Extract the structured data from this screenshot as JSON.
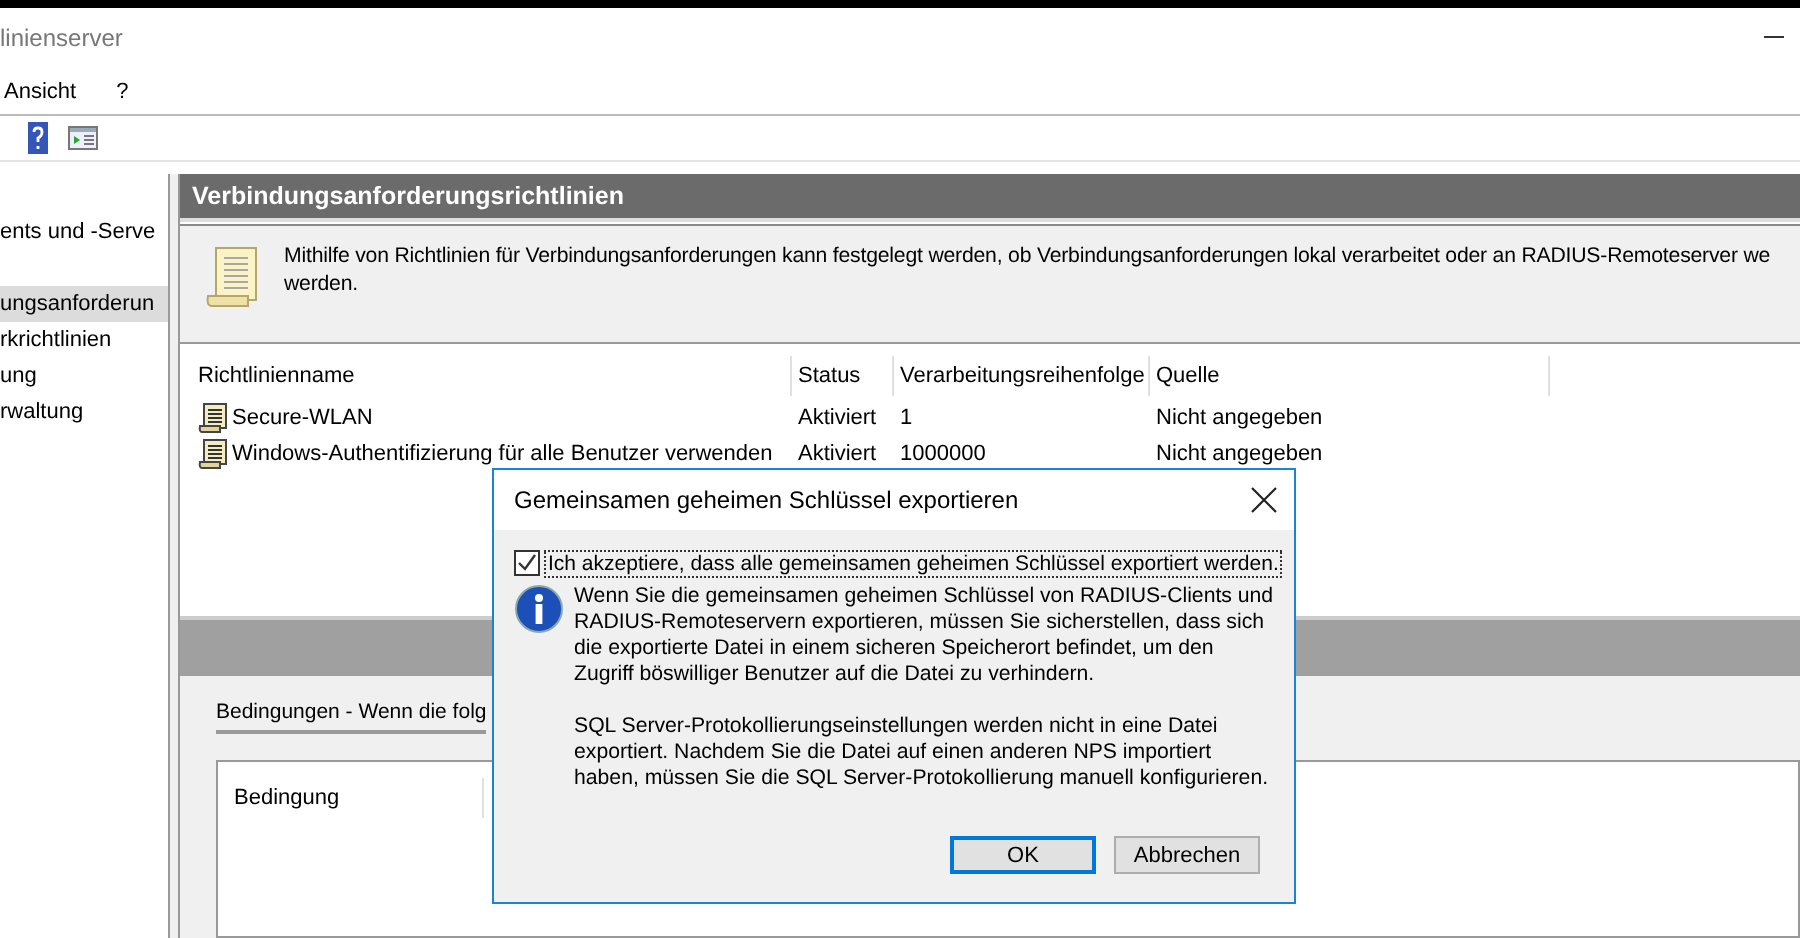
{
  "window": {
    "title": "linienserver"
  },
  "menu": [
    "Ansicht",
    "?"
  ],
  "tree": {
    "items": [
      {
        "label": "ents und -Serve",
        "selected": false
      },
      {
        "label": "ungsanforderun",
        "selected": true
      },
      {
        "label": "rkrichtlinien",
        "selected": false
      },
      {
        "label": "ung",
        "selected": false
      },
      {
        "label": "rwaltung",
        "selected": false
      }
    ]
  },
  "pane": {
    "title": "Verbindungsanforderungsrichtlinien",
    "description": [
      "Mithilfe von Richtlinien für Verbindungsanforderungen kann festgelegt werden, ob Verbindungsanforderungen lokal verarbeitet oder an RADIUS-Remoteserver we",
      "werden."
    ]
  },
  "policies": {
    "columns": [
      "Richtlinienname",
      "Status",
      "Verarbeitungsreihenfolge",
      "Quelle"
    ],
    "rows": [
      {
        "cells": [
          "Secure-WLAN",
          "Aktiviert",
          "1",
          "Nicht angegeben"
        ]
      },
      {
        "cells": [
          "Windows-Authentifizierung für alle Benutzer verwenden",
          "Aktiviert",
          "1000000",
          "Nicht angegeben"
        ]
      }
    ]
  },
  "conditions": {
    "title": "Bedingungen - Wenn die folg",
    "columns": [
      "Bedingung"
    ]
  },
  "dialog": {
    "title": "Gemeinsamen geheimen Schlüssel exportieren",
    "checkbox": {
      "label": "Ich akzeptiere, dass alle gemeinsamen geheimen Schlüssel exportiert werden.",
      "checked": true
    },
    "paragraphs": [
      "Wenn Sie die gemeinsamen geheimen Schlüssel von RADIUS-Clients und RADIUS-Remoteservern exportieren, müssen Sie sicherstellen, dass sich die exportierte Datei in einem sicheren Speicherort befindet, um den Zugriff böswilliger Benutzer auf die Datei zu verhindern.",
      "SQL Server-Protokollierungseinstellungen werden nicht in eine Datei exportiert. Nachdem Sie die Datei auf einen anderen NPS importiert haben, müssen Sie die SQL Server-Protokollierung manuell konfigurieren."
    ],
    "buttons": [
      {
        "label": "OK",
        "default": true
      },
      {
        "label": "Abbrechen",
        "default": false
      }
    ]
  }
}
